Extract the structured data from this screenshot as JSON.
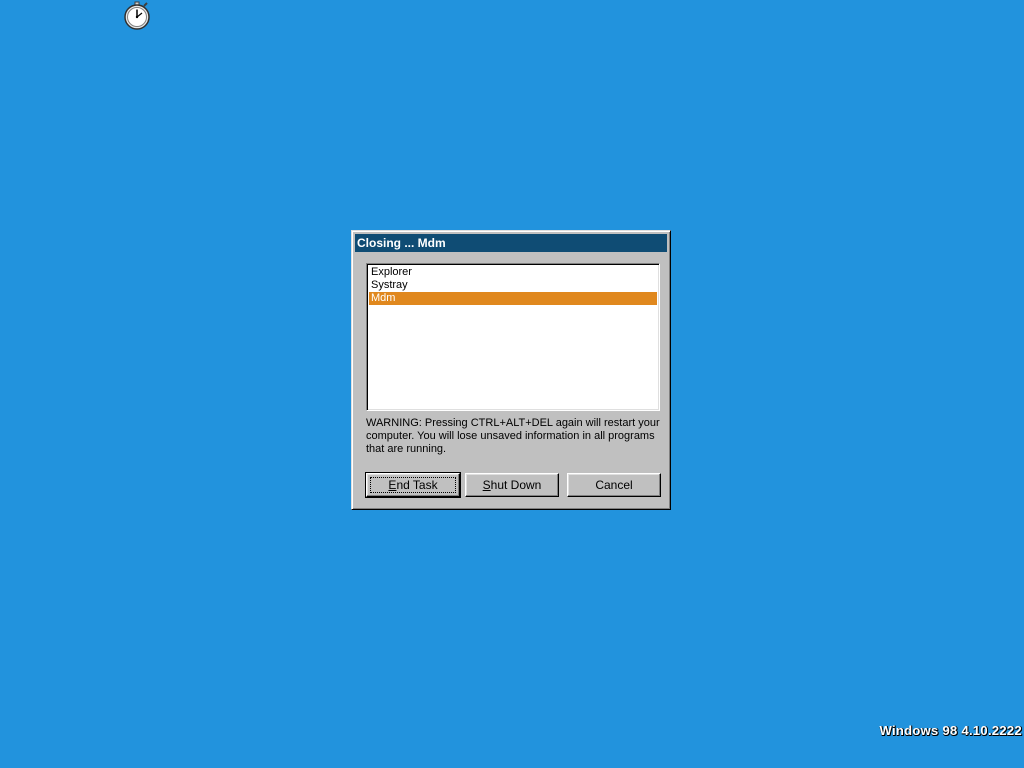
{
  "desktop": {
    "background_color": "#2293dd",
    "icon": "stopwatch-icon",
    "version_text": "Windows 98 4.10.2222"
  },
  "dialog": {
    "title": "Closing ... Mdm",
    "title_bar_color": "#0f4c74",
    "tasks": [
      {
        "label": "Explorer",
        "selected": false
      },
      {
        "label": "Systray",
        "selected": false
      },
      {
        "label": "Mdm",
        "selected": true
      }
    ],
    "selection_color": "#e0881e",
    "warning": "WARNING: Pressing CTRL+ALT+DEL again will restart your computer. You will lose unsaved information in all programs that are running.",
    "buttons": {
      "end_task": {
        "accel": "E",
        "rest": "nd Task"
      },
      "shut_down": {
        "accel": "S",
        "rest": "hut Down"
      },
      "cancel": {
        "label": "Cancel"
      }
    }
  }
}
